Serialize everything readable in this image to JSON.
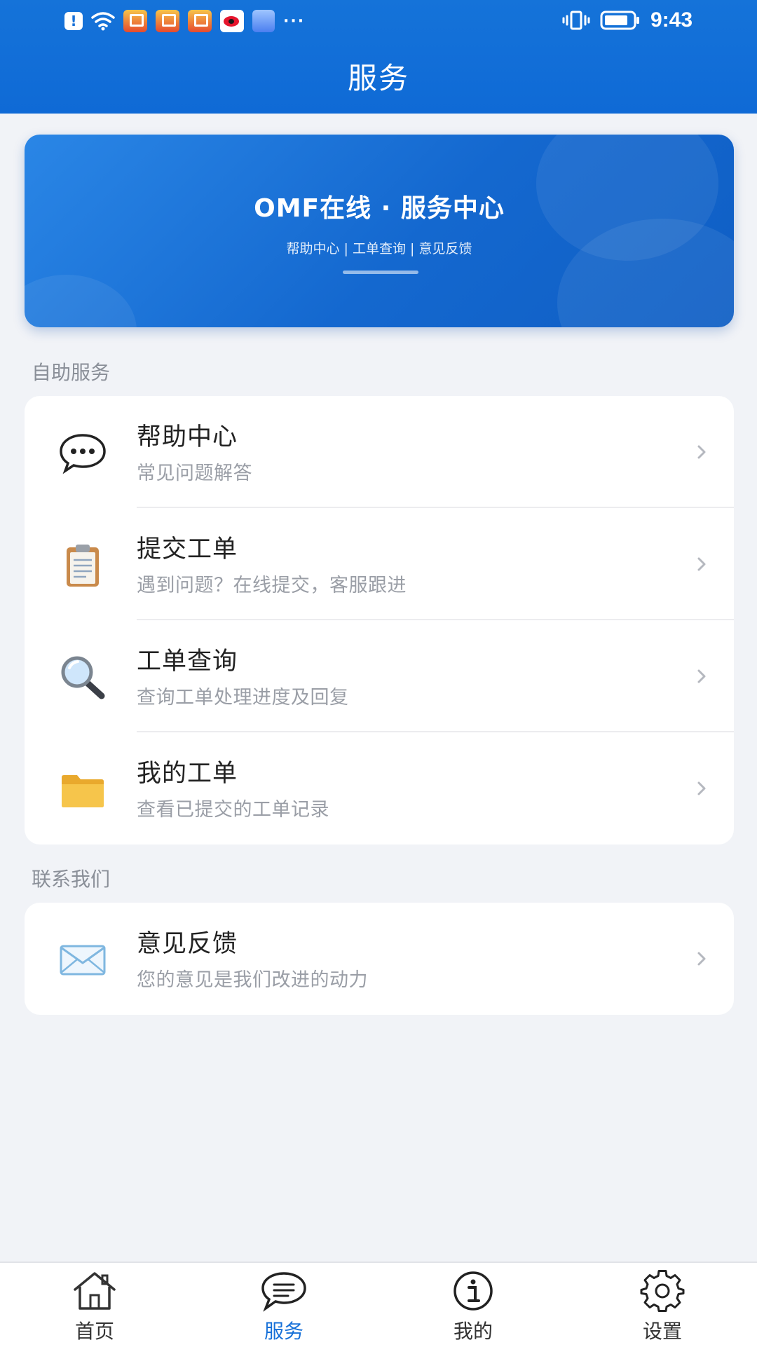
{
  "status_bar": {
    "time": "9:43"
  },
  "header": {
    "title": "服务"
  },
  "banner": {
    "title": "OMF在线 · 服务中心",
    "subtitle": "帮助中心 | 工单查询 | 意见反馈"
  },
  "sections": [
    {
      "label": "自助服务",
      "items": [
        {
          "icon": "speech-bubble-icon",
          "title": "帮助中心",
          "subtitle": "常见问题解答"
        },
        {
          "icon": "clipboard-icon",
          "title": "提交工单",
          "subtitle": "遇到问题？在线提交，客服跟进"
        },
        {
          "icon": "magnifier-icon",
          "title": "工单查询",
          "subtitle": "查询工单处理进度及回复"
        },
        {
          "icon": "folder-icon",
          "title": "我的工单",
          "subtitle": "查看已提交的工单记录"
        }
      ]
    },
    {
      "label": "联系我们",
      "items": [
        {
          "icon": "envelope-icon",
          "title": "意见反馈",
          "subtitle": "您的意见是我们改进的动力"
        }
      ]
    }
  ],
  "tabbar": {
    "active": "服务",
    "items": [
      {
        "icon": "home-icon",
        "label": "首页"
      },
      {
        "icon": "chat-icon",
        "label": "服务"
      },
      {
        "icon": "info-icon",
        "label": "我的"
      },
      {
        "icon": "gear-icon",
        "label": "设置"
      }
    ]
  },
  "colors": {
    "primary": "#1670d8",
    "background": "#f1f3f7",
    "card": "#ffffff",
    "subtitle_text": "#9a9ea6"
  }
}
